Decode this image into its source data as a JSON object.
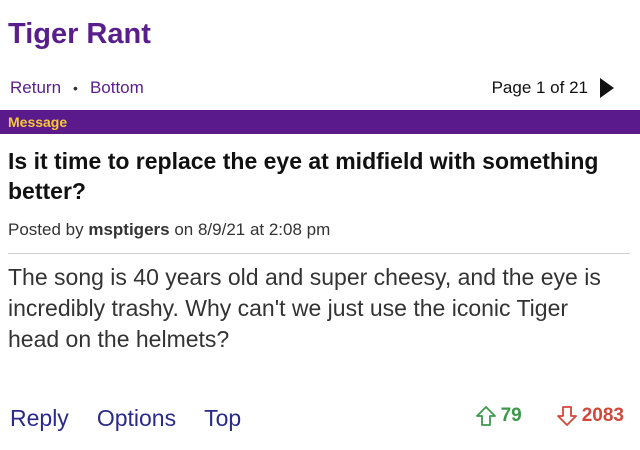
{
  "header": {
    "title": "Tiger Rant"
  },
  "nav": {
    "return_label": "Return",
    "separator": "•",
    "bottom_label": "Bottom",
    "page_label": "Page 1 of 21",
    "next_icon": "play-arrow-icon"
  },
  "message_bar": {
    "label": "Message"
  },
  "thread": {
    "title": "Is it time to replace the eye at midfield with something better?",
    "posted_prefix": "Posted by",
    "author": "msptigers",
    "posted_suffix": "on 8/9/21 at 2:08 pm",
    "body": "The song is 40 years old and super cheesy, and the eye is incredibly trashy. Why can't we just use the iconic Tiger head on the helmets?"
  },
  "actions": {
    "reply_label": "Reply",
    "options_label": "Options",
    "top_label": "Top"
  },
  "votes": {
    "up_count": "79",
    "down_count": "2083",
    "up_color": "#3c9a4a",
    "down_color": "#d0483a",
    "up_icon": "arrow-up-icon",
    "down_icon": "arrow-down-icon"
  },
  "colors": {
    "brand_purple": "#5a1e8c",
    "bar_gold": "#f5c838",
    "link_navy": "#2a2a8a"
  }
}
